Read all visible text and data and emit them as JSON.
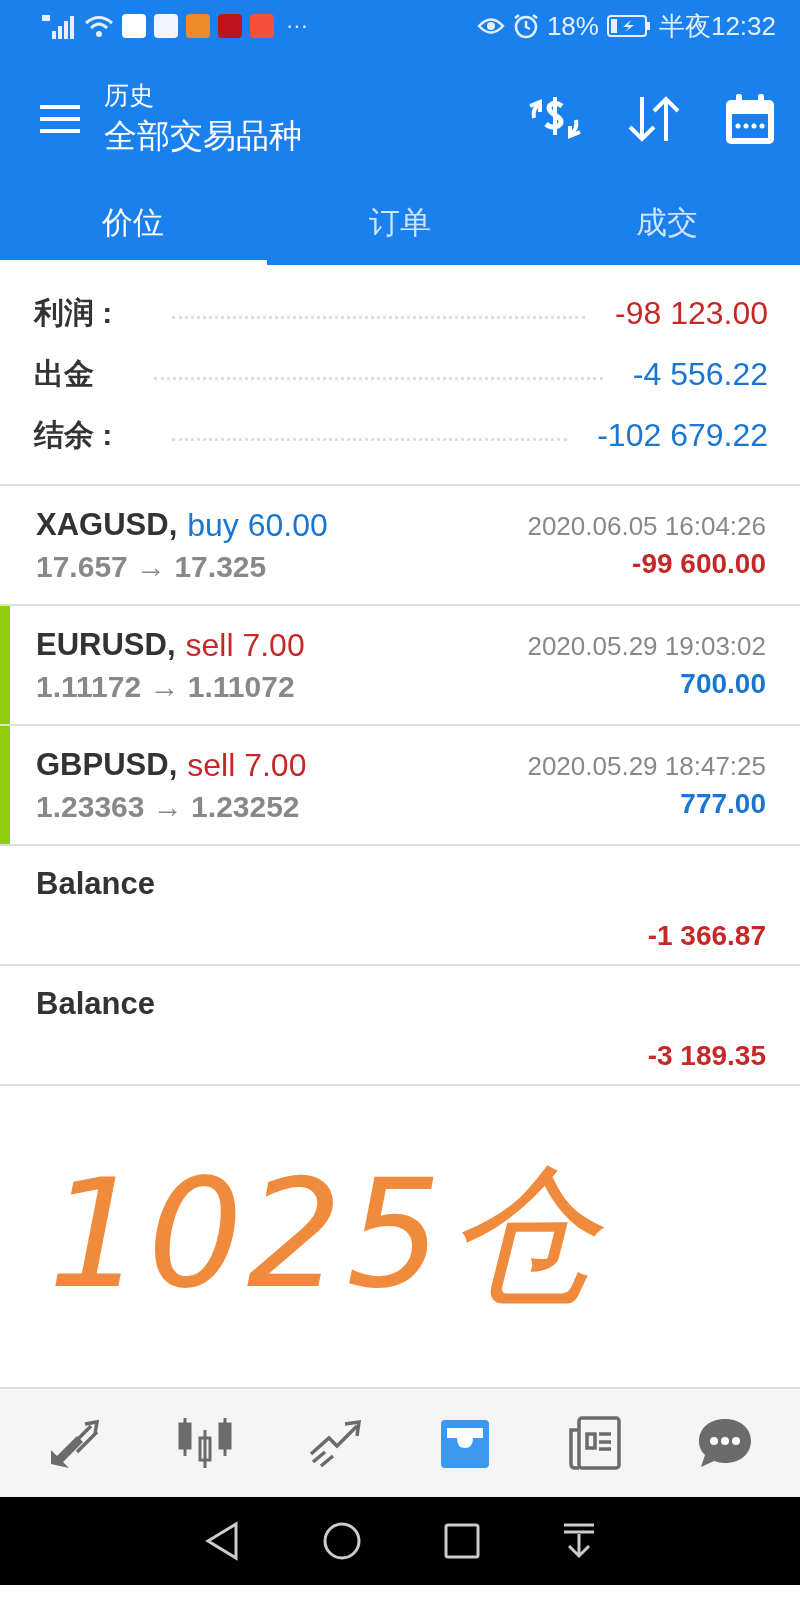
{
  "status_bar": {
    "more": "···",
    "battery": "18%",
    "time": "半夜12:32"
  },
  "app_bar": {
    "subtitle": "历史",
    "title": "全部交易品种"
  },
  "tabs": [
    {
      "label": "价位",
      "selected": true
    },
    {
      "label": "订单",
      "selected": false
    },
    {
      "label": "成交",
      "selected": false
    }
  ],
  "summary": [
    {
      "label": "利润 :",
      "value": "-98 123.00",
      "color": "#c62828"
    },
    {
      "label": "出金",
      "value": "-4 556.22",
      "color": "#1976d2"
    },
    {
      "label": "结余 :",
      "value": "-102 679.22",
      "color": "#1976d2"
    }
  ],
  "deals": [
    {
      "kind": "trade",
      "symbol": "XAGUSD,",
      "side": {
        "text": "buy 60.00",
        "color": "#1976d2"
      },
      "prices": "17.657 → 17.325",
      "time": "2020.06.05 16:04:26",
      "profit": {
        "text": "-99 600.00",
        "color": "#c62828"
      },
      "marked": false
    },
    {
      "kind": "trade",
      "symbol": "EURUSD,",
      "side": {
        "text": "sell 7.00",
        "color": "#c62828"
      },
      "prices": "1.11172 → 1.11072",
      "time": "2020.05.29 19:03:02",
      "profit": {
        "text": "700.00",
        "color": "#1976d2"
      },
      "marked": true
    },
    {
      "kind": "trade",
      "symbol": "GBPUSD,",
      "side": {
        "text": "sell 7.00",
        "color": "#c62828"
      },
      "prices": "1.23363 → 1.23252",
      "time": "2020.05.29 18:47:25",
      "profit": {
        "text": "777.00",
        "color": "#1976d2"
      },
      "marked": true
    },
    {
      "kind": "balance",
      "symbol": "Balance",
      "profit": {
        "text": "-1 366.87",
        "color": "#c62828"
      },
      "marked": false
    },
    {
      "kind": "balance",
      "symbol": "Balance",
      "profit": {
        "text": "-3 189.35",
        "color": "#c62828"
      },
      "marked": false
    }
  ],
  "annotation": "1025仓",
  "bottom_nav": [
    {
      "selected": false
    },
    {
      "selected": false
    },
    {
      "selected": false
    },
    {
      "selected": true
    },
    {
      "selected": false
    },
    {
      "selected": false
    }
  ]
}
